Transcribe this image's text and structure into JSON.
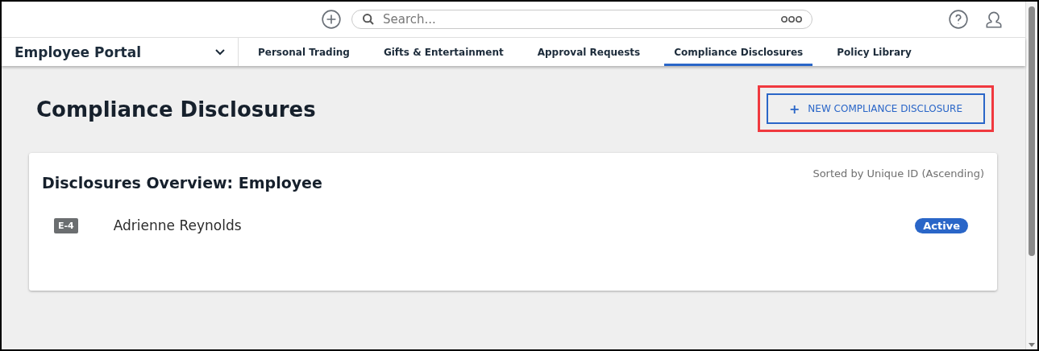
{
  "search": {
    "placeholder": "Search..."
  },
  "portal": {
    "label": "Employee Portal"
  },
  "nav_tabs": [
    {
      "label": "Personal Trading",
      "selected": false
    },
    {
      "label": "Gifts & Entertainment",
      "selected": false
    },
    {
      "label": "Approval Requests",
      "selected": false
    },
    {
      "label": "Compliance Disclosures",
      "selected": true
    },
    {
      "label": "Policy Library",
      "selected": false
    }
  ],
  "page_title": "Compliance Disclosures",
  "new_button": {
    "icon": "+",
    "label": "NEW COMPLIANCE DISCLOSURE",
    "highlighted": true
  },
  "card": {
    "title": "Disclosures Overview: Employee",
    "sort_note": "Sorted by Unique ID (Ascending)",
    "rows": [
      {
        "id": "E-4",
        "name": "Adrienne Reynolds",
        "status": "Active"
      }
    ]
  }
}
